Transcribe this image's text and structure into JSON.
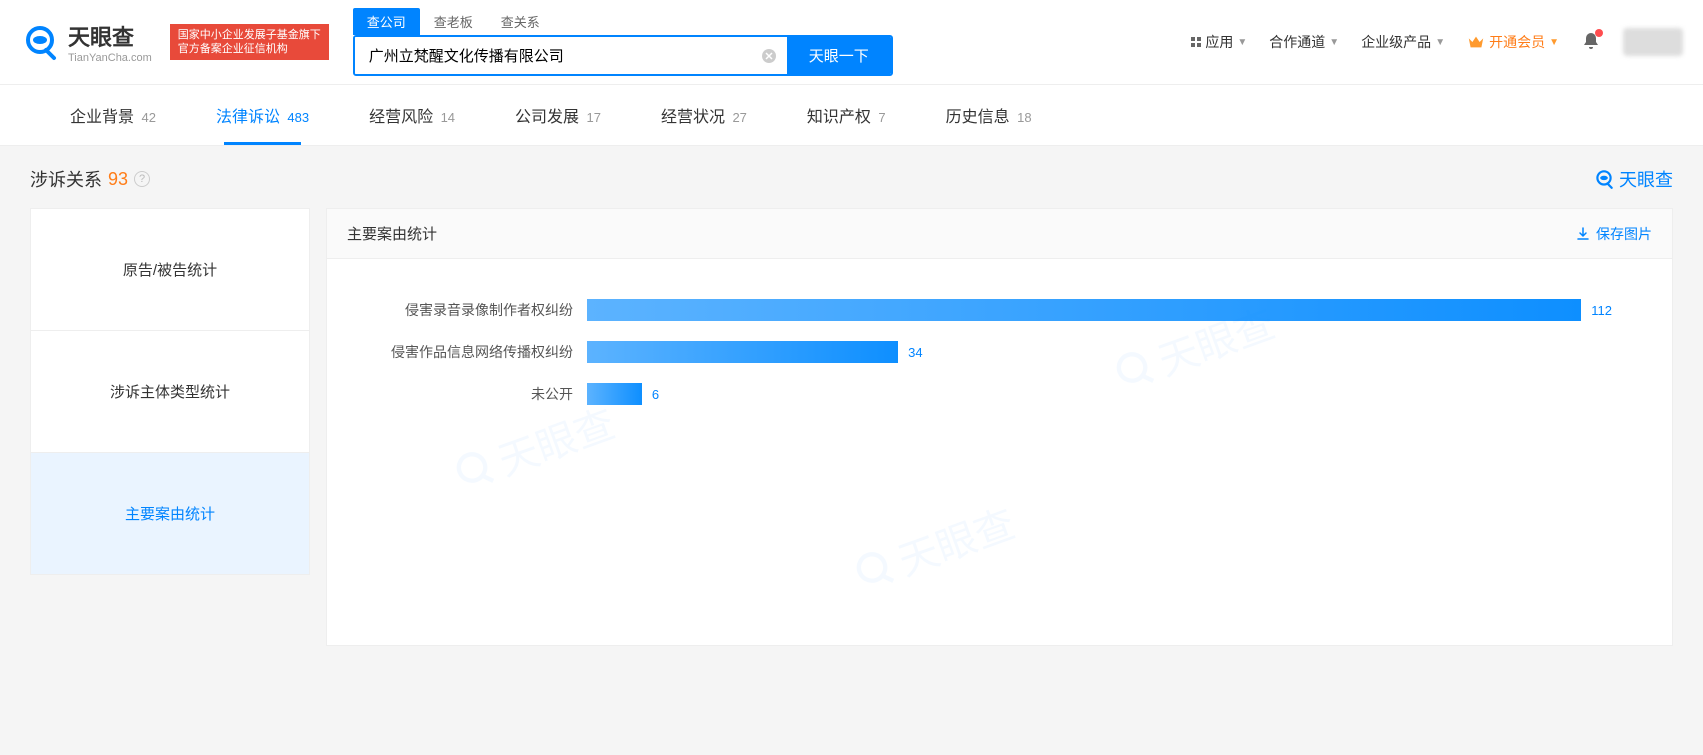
{
  "logo": {
    "cn": "天眼查",
    "en": "TianYanCha.com"
  },
  "red_badge": {
    "line1": "国家中小企业发展子基金旗下",
    "line2": "官方备案企业征信机构"
  },
  "search_tabs": [
    {
      "label": "查公司",
      "active": true
    },
    {
      "label": "查老板",
      "active": false
    },
    {
      "label": "查关系",
      "active": false
    }
  ],
  "search": {
    "value": "广州立梵醒文化传播有限公司",
    "button": "天眼一下"
  },
  "header_links": {
    "apps": "应用",
    "coop": "合作通道",
    "enterprise": "企业级产品",
    "vip": "开通会员"
  },
  "main_tabs": [
    {
      "label": "企业背景",
      "count": "42",
      "active": false
    },
    {
      "label": "法律诉讼",
      "count": "483",
      "active": true
    },
    {
      "label": "经营风险",
      "count": "14",
      "active": false
    },
    {
      "label": "公司发展",
      "count": "17",
      "active": false
    },
    {
      "label": "经营状况",
      "count": "27",
      "active": false
    },
    {
      "label": "知识产权",
      "count": "7",
      "active": false
    },
    {
      "label": "历史信息",
      "count": "18",
      "active": false
    }
  ],
  "section": {
    "title": "涉诉关系",
    "count": "93"
  },
  "watermark_text": "天眼查",
  "side_tabs": [
    {
      "label": "原告/被告统计",
      "active": false
    },
    {
      "label": "涉诉主体类型统计",
      "active": false
    },
    {
      "label": "主要案由统计",
      "active": true
    }
  ],
  "chart": {
    "title": "主要案由统计",
    "save": "保存图片"
  },
  "chart_data": {
    "type": "bar",
    "title": "主要案由统计",
    "xlabel": "",
    "ylabel": "",
    "categories": [
      "侵害录音录像制作者权纠纷",
      "侵害作品信息网络传播权纠纷",
      "未公开"
    ],
    "values": [
      112,
      34,
      6
    ],
    "max": 112
  }
}
